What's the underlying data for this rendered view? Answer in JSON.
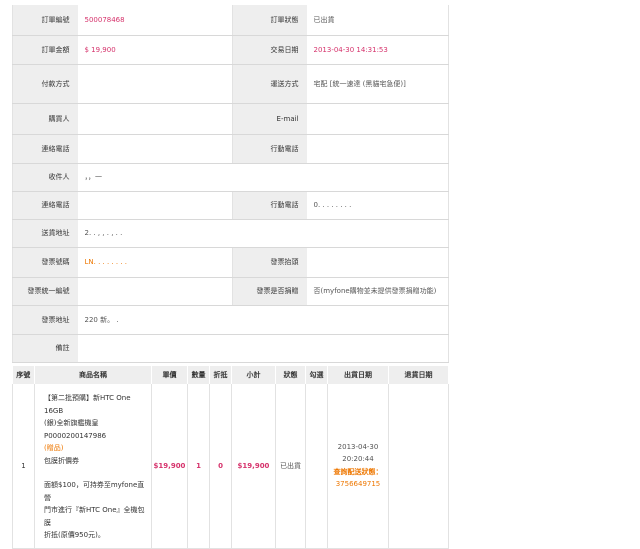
{
  "order": {
    "order_no_label": "訂單編號",
    "order_no": "500078468",
    "status_label": "訂單狀態",
    "status": "已出貨",
    "amount_label": "訂單金額",
    "amount": "$ 19,900",
    "trade_date_label": "交易日期",
    "trade_date": "2013-04-30 14:31:53",
    "payment_label": "付款方式",
    "payment": "",
    "shipping_label": "運送方式",
    "shipping": "宅配 [統一速達 (黑貓宅急便)]",
    "buyer_label": "購買人",
    "buyer": "",
    "email_label": "E-mail",
    "email": "",
    "phone_label": "連絡電話",
    "phone": "",
    "mobile_label": "行動電話",
    "mobile": "",
    "recipient_label": "收件人",
    "recipient": "，，一",
    "r_phone_label": "連絡電話",
    "r_phone": "",
    "r_mobile_label": "行動電話",
    "r_mobile": "0. . . . . .  .  .",
    "address_label": "送貨地址",
    "address": "2. .  ,  , .  ,     .  .",
    "invoice_no_label": "發票號碼",
    "invoice_no": "LN. . . . . . . .",
    "invoice_title_label": "發票抬頭",
    "invoice_title": "",
    "tax_id_label": "發票統一編號",
    "tax_id": "",
    "donate_label": "發票是否捐贈",
    "donate": "否(myfone購物並未提供發票捐贈功能)",
    "invoice_addr_label": "發票地址",
    "invoice_addr": "220 新。 .",
    "note_label": "備註",
    "note": ""
  },
  "items_table": {
    "headers": [
      "序號",
      "商品名稱",
      "單價",
      "數量",
      "折抵",
      "小計",
      "狀態",
      "勾選",
      "出貨日期",
      "退貨日期"
    ],
    "rows": [
      {
        "seq": "1",
        "name_lines": [
          "【第二批預購】新HTC One 16GB",
          "(銀)全新旗艦機皇",
          "P0000200147986"
        ],
        "gift_tag": "(贈品)",
        "gift_line": "包膜折價券",
        "gift_desc_lines": [
          "面額$100，可持券至myfone直營",
          "門市進行『新HTC One』全機包膜",
          "折抵(原價950元)。"
        ],
        "price": "$19,900",
        "qty": "1",
        "discount": "0",
        "subtotal": "$19,900",
        "status": "已出貨",
        "check": "",
        "ship_date": "2013-04-30",
        "ship_time": "20:20:44",
        "tracking_label": "查詢配送狀態：",
        "tracking_no": "3756649715",
        "return_date": ""
      }
    ]
  },
  "colors": {
    "pink": "#d6336c",
    "orange": "#ee7700",
    "label_bg": "#eeeeee"
  }
}
